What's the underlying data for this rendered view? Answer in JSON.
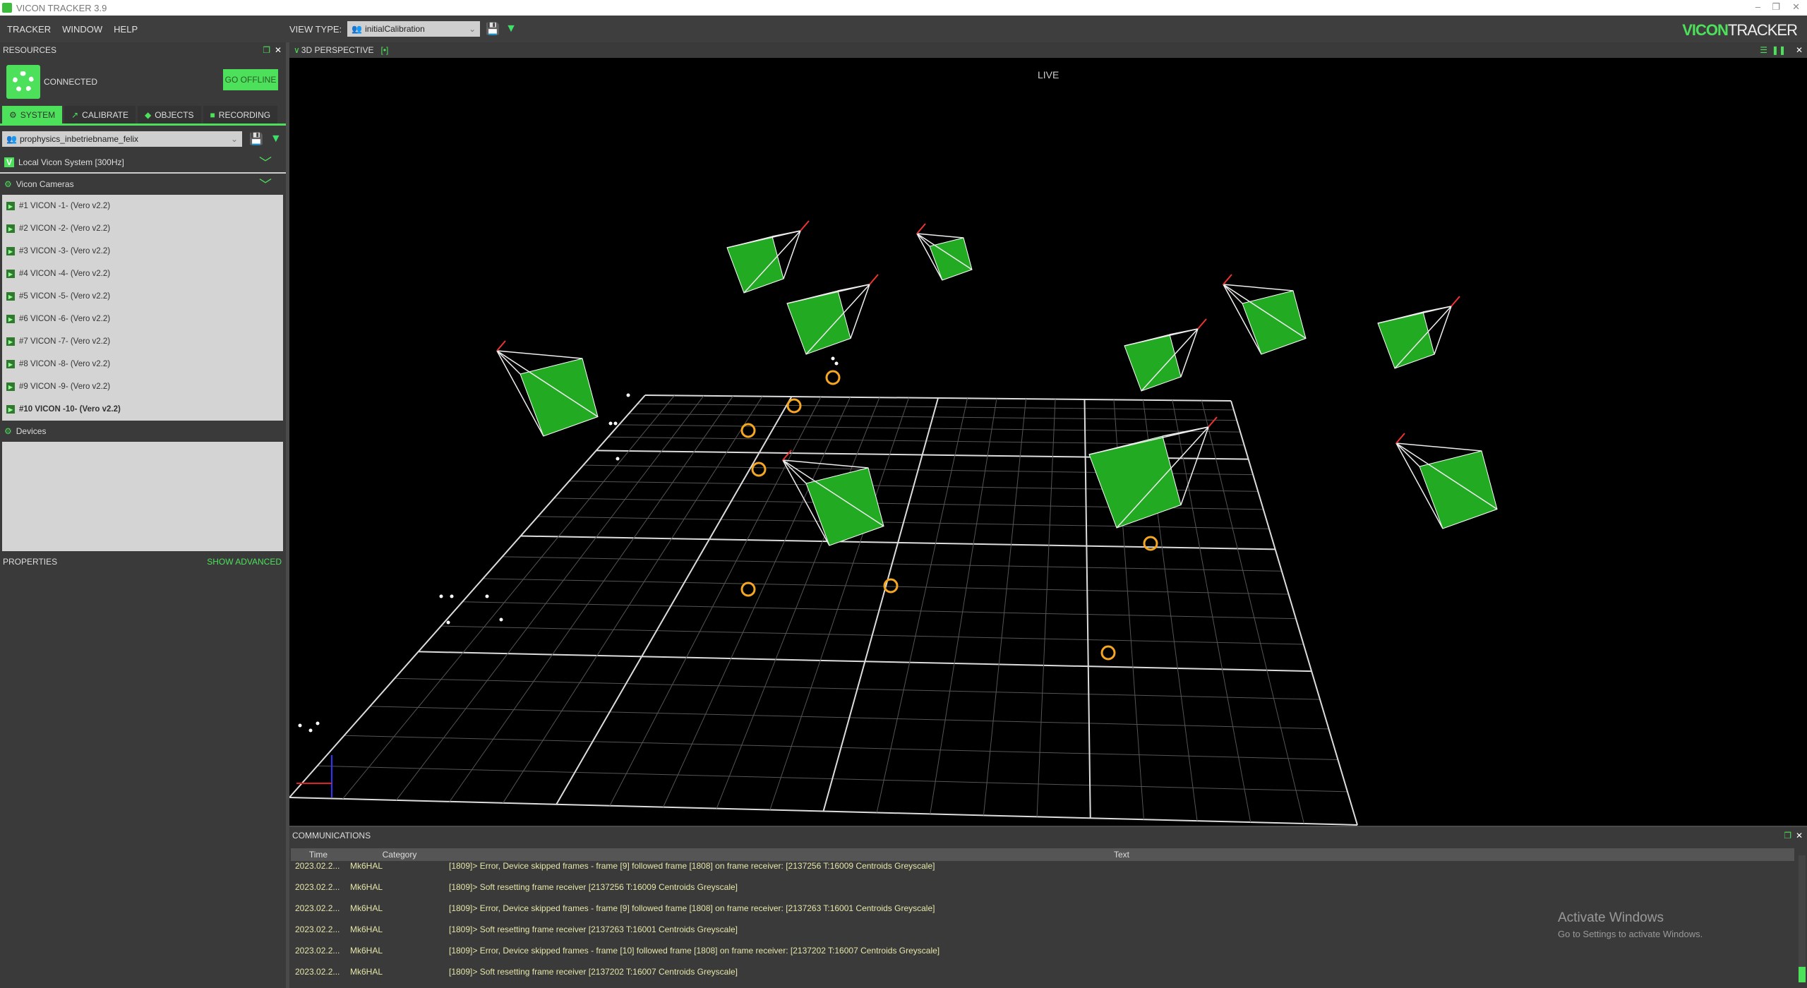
{
  "window": {
    "title": "VICON TRACKER 3.9",
    "controls": [
      "–",
      "❐",
      "✕"
    ]
  },
  "menu": [
    "TRACKER",
    "WINDOW",
    "HELP"
  ],
  "view_type": {
    "label": "VIEW TYPE:",
    "value": "initialCalibration"
  },
  "brand": {
    "a": "VICON",
    "b": "TRACKER"
  },
  "resources": {
    "title": "RESOURCES",
    "status": "CONNECTED",
    "go_offline": "GO OFFLINE",
    "tabs": [
      "SYSTEM",
      "CALIBRATE",
      "OBJECTS",
      "RECORDING"
    ],
    "config": "prophysics_inbetriebname_felix",
    "system": "Local Vicon System [300Hz]",
    "cameras_title": "Vicon Cameras",
    "cameras": [
      "#1 VICON -1- (Vero v2.2)",
      "#2 VICON -2- (Vero v2.2)",
      "#3 VICON -3- (Vero v2.2)",
      "#4 VICON -4- (Vero v2.2)",
      "#5 VICON -5- (Vero v2.2)",
      "#6 VICON -6- (Vero v2.2)",
      "#7 VICON -7- (Vero v2.2)",
      "#8 VICON -8- (Vero v2.2)",
      "#9 VICON -9- (Vero v2.2)",
      "#10 VICON -10- (Vero v2.2)"
    ],
    "selected_camera": 9,
    "devices": "Devices"
  },
  "properties": {
    "title": "PROPERTIES",
    "show_advanced": "SHOW ADVANCED"
  },
  "viewport": {
    "title": "3D PERSPECTIVE",
    "mode": "LIVE"
  },
  "communications": {
    "title": "COMMUNICATIONS",
    "columns": [
      "Time",
      "Category",
      "Text"
    ],
    "rows": [
      [
        "2023.02.2...",
        "Mk6HAL",
        "[1809]> Error, Device skipped frames - frame [9] followed frame [1808] on frame receiver: [2137256 T:16009 Centroids Greyscale]"
      ],
      [
        "2023.02.2...",
        "Mk6HAL",
        "[1809]> Soft resetting frame receiver [2137256 T:16009 Centroids Greyscale]"
      ],
      [
        "2023.02.2...",
        "Mk6HAL",
        "[1809]> Error, Device skipped frames - frame [9] followed frame [1808] on frame receiver: [2137263 T:16001 Centroids Greyscale]"
      ],
      [
        "2023.02.2...",
        "Mk6HAL",
        "[1809]> Soft resetting frame receiver [2137263 T:16001 Centroids Greyscale]"
      ],
      [
        "2023.02.2...",
        "Mk6HAL",
        "[1809]> Error, Device skipped frames - frame [10] followed frame [1808] on frame receiver: [2137202 T:16007 Centroids Greyscale]"
      ],
      [
        "2023.02.2...",
        "Mk6HAL",
        "[1809]> Soft resetting frame receiver [2137202 T:16007 Centroids Greyscale]"
      ]
    ]
  },
  "watermark": {
    "title": "Activate Windows",
    "sub": "Go to Settings to activate Windows."
  },
  "colors": {
    "accent": "#4de05a",
    "panel": "#3a3a3a",
    "viewport": "#000000"
  }
}
